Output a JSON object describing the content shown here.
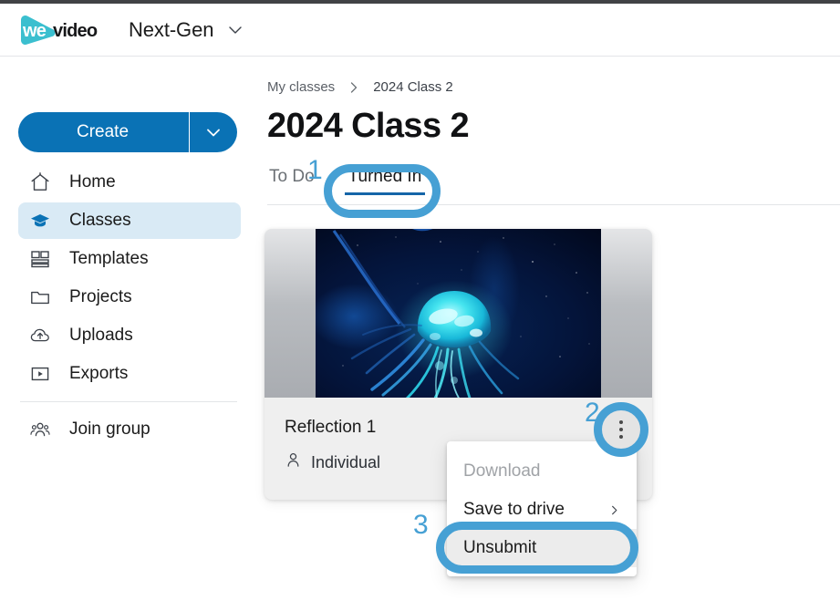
{
  "header": {
    "logo_name": "wevideo-logo",
    "logo_text_light": "we",
    "logo_text_dark": "video",
    "workspace": "Next-Gen",
    "workspace_caret_icon": "chevron-down-icon"
  },
  "sidebar": {
    "create": {
      "label": "Create",
      "caret_icon": "chevron-down-icon"
    },
    "items": [
      {
        "label": "Home",
        "icon": "home-icon",
        "active": false
      },
      {
        "label": "Classes",
        "icon": "graduation-cap-icon",
        "active": true
      },
      {
        "label": "Templates",
        "icon": "templates-grid-icon",
        "active": false
      },
      {
        "label": "Projects",
        "icon": "folder-icon",
        "active": false
      },
      {
        "label": "Uploads",
        "icon": "cloud-upload-icon",
        "active": false
      },
      {
        "label": "Exports",
        "icon": "play-square-icon",
        "active": false
      }
    ],
    "group_item": {
      "label": "Join group",
      "icon": "people-group-icon"
    }
  },
  "main": {
    "breadcrumb": {
      "root": "My classes",
      "separator_icon": "chevron-right-icon",
      "current": "2024 Class 2"
    },
    "title": "2024 Class 2",
    "tabs": [
      {
        "label": "To Do",
        "active": false
      },
      {
        "label": "Turned In",
        "active": true
      }
    ],
    "card": {
      "thumbnail_alt": "jellyfish-video-thumbnail",
      "title": "Reflection 1",
      "meta_icon": "person-icon",
      "meta_label": "Individual",
      "kebab_icon": "more-vertical-icon"
    },
    "menu": [
      {
        "label": "Download",
        "state": "disabled",
        "submenu_caret": ""
      },
      {
        "label": "Save to drive",
        "state": "enabled",
        "submenu_caret": "chevron-right-icon"
      },
      {
        "label": "Unsubmit",
        "state": "hovered",
        "submenu_caret": ""
      }
    ]
  },
  "annotations": {
    "color": "#46a0d4",
    "steps": [
      {
        "number": "1",
        "target": "Turned In"
      },
      {
        "number": "2",
        "target": "more-vertical-icon"
      },
      {
        "number": "3",
        "target": "Unsubmit"
      }
    ]
  }
}
